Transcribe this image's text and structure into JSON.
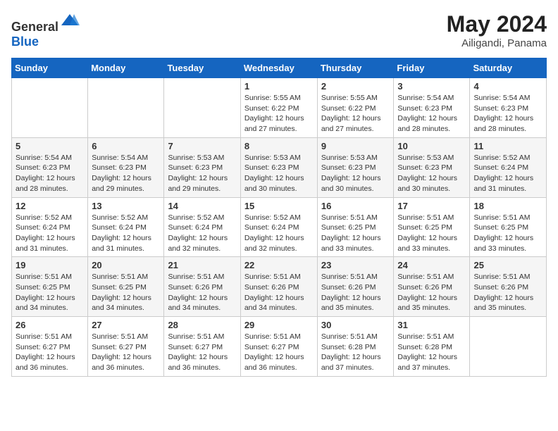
{
  "header": {
    "logo_general": "General",
    "logo_blue": "Blue",
    "month_year": "May 2024",
    "location": "Ailigandi, Panama"
  },
  "days_of_week": [
    "Sunday",
    "Monday",
    "Tuesday",
    "Wednesday",
    "Thursday",
    "Friday",
    "Saturday"
  ],
  "weeks": [
    [
      {
        "day": "",
        "sunrise": "",
        "sunset": "",
        "daylight": ""
      },
      {
        "day": "",
        "sunrise": "",
        "sunset": "",
        "daylight": ""
      },
      {
        "day": "",
        "sunrise": "",
        "sunset": "",
        "daylight": ""
      },
      {
        "day": "1",
        "sunrise": "5:55 AM",
        "sunset": "6:22 PM",
        "daylight": "12 hours and 27 minutes."
      },
      {
        "day": "2",
        "sunrise": "5:55 AM",
        "sunset": "6:22 PM",
        "daylight": "12 hours and 27 minutes."
      },
      {
        "day": "3",
        "sunrise": "5:54 AM",
        "sunset": "6:23 PM",
        "daylight": "12 hours and 28 minutes."
      },
      {
        "day": "4",
        "sunrise": "5:54 AM",
        "sunset": "6:23 PM",
        "daylight": "12 hours and 28 minutes."
      }
    ],
    [
      {
        "day": "5",
        "sunrise": "5:54 AM",
        "sunset": "6:23 PM",
        "daylight": "12 hours and 28 minutes."
      },
      {
        "day": "6",
        "sunrise": "5:54 AM",
        "sunset": "6:23 PM",
        "daylight": "12 hours and 29 minutes."
      },
      {
        "day": "7",
        "sunrise": "5:53 AM",
        "sunset": "6:23 PM",
        "daylight": "12 hours and 29 minutes."
      },
      {
        "day": "8",
        "sunrise": "5:53 AM",
        "sunset": "6:23 PM",
        "daylight": "12 hours and 30 minutes."
      },
      {
        "day": "9",
        "sunrise": "5:53 AM",
        "sunset": "6:23 PM",
        "daylight": "12 hours and 30 minutes."
      },
      {
        "day": "10",
        "sunrise": "5:53 AM",
        "sunset": "6:23 PM",
        "daylight": "12 hours and 30 minutes."
      },
      {
        "day": "11",
        "sunrise": "5:52 AM",
        "sunset": "6:24 PM",
        "daylight": "12 hours and 31 minutes."
      }
    ],
    [
      {
        "day": "12",
        "sunrise": "5:52 AM",
        "sunset": "6:24 PM",
        "daylight": "12 hours and 31 minutes."
      },
      {
        "day": "13",
        "sunrise": "5:52 AM",
        "sunset": "6:24 PM",
        "daylight": "12 hours and 31 minutes."
      },
      {
        "day": "14",
        "sunrise": "5:52 AM",
        "sunset": "6:24 PM",
        "daylight": "12 hours and 32 minutes."
      },
      {
        "day": "15",
        "sunrise": "5:52 AM",
        "sunset": "6:24 PM",
        "daylight": "12 hours and 32 minutes."
      },
      {
        "day": "16",
        "sunrise": "5:51 AM",
        "sunset": "6:25 PM",
        "daylight": "12 hours and 33 minutes."
      },
      {
        "day": "17",
        "sunrise": "5:51 AM",
        "sunset": "6:25 PM",
        "daylight": "12 hours and 33 minutes."
      },
      {
        "day": "18",
        "sunrise": "5:51 AM",
        "sunset": "6:25 PM",
        "daylight": "12 hours and 33 minutes."
      }
    ],
    [
      {
        "day": "19",
        "sunrise": "5:51 AM",
        "sunset": "6:25 PM",
        "daylight": "12 hours and 34 minutes."
      },
      {
        "day": "20",
        "sunrise": "5:51 AM",
        "sunset": "6:25 PM",
        "daylight": "12 hours and 34 minutes."
      },
      {
        "day": "21",
        "sunrise": "5:51 AM",
        "sunset": "6:26 PM",
        "daylight": "12 hours and 34 minutes."
      },
      {
        "day": "22",
        "sunrise": "5:51 AM",
        "sunset": "6:26 PM",
        "daylight": "12 hours and 34 minutes."
      },
      {
        "day": "23",
        "sunrise": "5:51 AM",
        "sunset": "6:26 PM",
        "daylight": "12 hours and 35 minutes."
      },
      {
        "day": "24",
        "sunrise": "5:51 AM",
        "sunset": "6:26 PM",
        "daylight": "12 hours and 35 minutes."
      },
      {
        "day": "25",
        "sunrise": "5:51 AM",
        "sunset": "6:26 PM",
        "daylight": "12 hours and 35 minutes."
      }
    ],
    [
      {
        "day": "26",
        "sunrise": "5:51 AM",
        "sunset": "6:27 PM",
        "daylight": "12 hours and 36 minutes."
      },
      {
        "day": "27",
        "sunrise": "5:51 AM",
        "sunset": "6:27 PM",
        "daylight": "12 hours and 36 minutes."
      },
      {
        "day": "28",
        "sunrise": "5:51 AM",
        "sunset": "6:27 PM",
        "daylight": "12 hours and 36 minutes."
      },
      {
        "day": "29",
        "sunrise": "5:51 AM",
        "sunset": "6:27 PM",
        "daylight": "12 hours and 36 minutes."
      },
      {
        "day": "30",
        "sunrise": "5:51 AM",
        "sunset": "6:28 PM",
        "daylight": "12 hours and 37 minutes."
      },
      {
        "day": "31",
        "sunrise": "5:51 AM",
        "sunset": "6:28 PM",
        "daylight": "12 hours and 37 minutes."
      },
      {
        "day": "",
        "sunrise": "",
        "sunset": "",
        "daylight": ""
      }
    ]
  ]
}
